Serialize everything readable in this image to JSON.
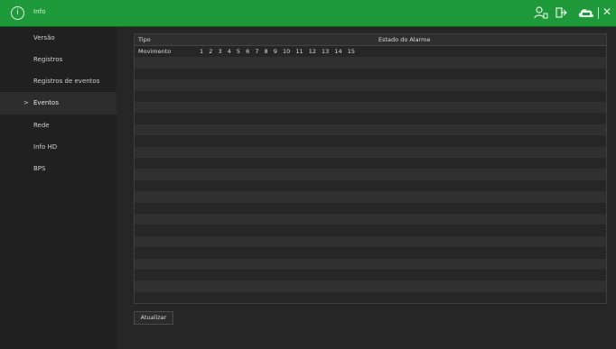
{
  "header": {
    "title": "Info",
    "icons": [
      "info-icon",
      "user-icon",
      "exit-icon",
      "cloud-icon",
      "close-icon"
    ],
    "accent": "#1f9a3a"
  },
  "sidebar": {
    "items": [
      {
        "label": "Versão",
        "active": false
      },
      {
        "label": "Registros",
        "active": false
      },
      {
        "label": "Registros de eventos",
        "active": false
      },
      {
        "label": "Eventos",
        "active": true
      },
      {
        "label": "Rede",
        "active": false
      },
      {
        "label": "Info HD",
        "active": false
      },
      {
        "label": "BPS",
        "active": false
      }
    ],
    "active_marker": ">"
  },
  "table": {
    "columns": [
      "Tipo",
      "Estado do Alarme"
    ],
    "rows": [
      {
        "type": "Movimento",
        "channels": [
          "1",
          "2",
          "3",
          "4",
          "5",
          "6",
          "7",
          "8",
          "9",
          "10",
          "11",
          "12",
          "13",
          "14",
          "15"
        ]
      }
    ]
  },
  "buttons": {
    "refresh_label": "Atualizar"
  }
}
